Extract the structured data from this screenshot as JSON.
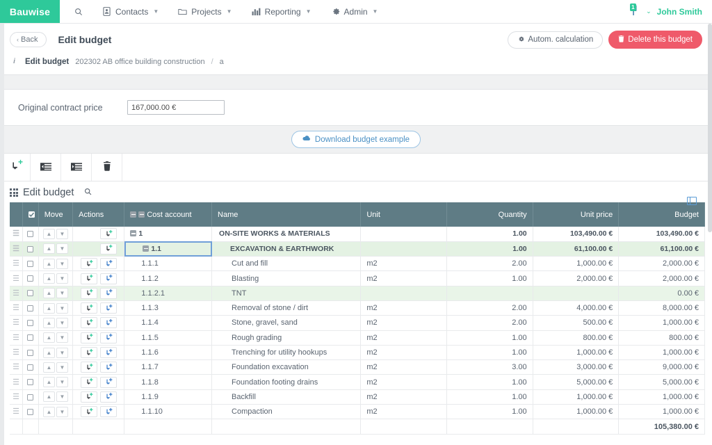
{
  "topnav": {
    "brand": "Bauwise",
    "items": [
      {
        "label": "",
        "icon": "search-icon",
        "caret": false
      },
      {
        "label": "Contacts",
        "icon": "contacts-icon",
        "caret": true
      },
      {
        "label": "Projects",
        "icon": "folder-icon",
        "caret": true
      },
      {
        "label": "Reporting",
        "icon": "chart-icon",
        "caret": true
      },
      {
        "label": "Admin",
        "icon": "gear-icon",
        "caret": true
      }
    ],
    "notification_badge": "1",
    "user_name": "John Smith"
  },
  "subheader": {
    "back_label": "Back",
    "page_title": "Edit budget",
    "autocalc_label": "Autom. calculation",
    "delete_label": "Delete this budget",
    "breadcrumb": {
      "current": "Edit budget",
      "project": "202302 AB office building construction",
      "separator": "/",
      "tail": "a"
    }
  },
  "contract": {
    "label": "Original contract price",
    "value": "167,000.00 €",
    "placeholder": ""
  },
  "download": {
    "label": "Download budget example",
    "icon": "cloud-download-icon"
  },
  "toolbar": {
    "buttons": [
      {
        "name": "add-row-button",
        "icon": "add-sub-row-icon"
      },
      {
        "name": "outdent-button",
        "icon": "outdent-icon"
      },
      {
        "name": "indent-button",
        "icon": "indent-icon"
      },
      {
        "name": "delete-row-button",
        "icon": "trash-icon"
      }
    ]
  },
  "grid": {
    "title": "Edit budget",
    "search_icon": "search-icon",
    "panel_icon": "columns-toggle-icon",
    "columns": [
      {
        "key": "handle",
        "label": ""
      },
      {
        "key": "check",
        "label": ""
      },
      {
        "key": "move",
        "label": "Move"
      },
      {
        "key": "actions",
        "label": "Actions"
      },
      {
        "key": "code",
        "label": "Cost account"
      },
      {
        "key": "name",
        "label": "Name"
      },
      {
        "key": "unit",
        "label": "Unit"
      },
      {
        "key": "qty",
        "label": "Quantity"
      },
      {
        "key": "price",
        "label": "Unit price"
      },
      {
        "key": "budget",
        "label": "Budget"
      }
    ],
    "rows": [
      {
        "code": "1",
        "name": "ON-SITE WORKS & MATERIALS",
        "unit": "",
        "qty": "1.00",
        "price": "103,490.00 €",
        "budget": "103,490.00 €",
        "level": 1,
        "collapsible": true,
        "selected": false,
        "indent": 0,
        "actions": 1
      },
      {
        "code": "1.1",
        "name": "EXCAVATION & EARTHWORK",
        "unit": "",
        "qty": "1.00",
        "price": "61,100.00 €",
        "budget": "61,100.00 €",
        "level": 2,
        "collapsible": true,
        "selected": true,
        "indent": 1,
        "actions": 1
      },
      {
        "code": "1.1.1",
        "name": "Cut and fill",
        "unit": "m2",
        "qty": "2.00",
        "price": "1,000.00 €",
        "budget": "2,000.00 €",
        "level": 3,
        "collapsible": false,
        "selected": false,
        "indent": 2,
        "actions": 2
      },
      {
        "code": "1.1.2",
        "name": "Blasting",
        "unit": "m2",
        "qty": "1.00",
        "price": "2,000.00 €",
        "budget": "2,000.00 €",
        "level": 3,
        "collapsible": false,
        "selected": false,
        "indent": 2,
        "actions": 2
      },
      {
        "code": "1.1.2.1",
        "name": "TNT",
        "unit": "",
        "qty": "",
        "price": "",
        "budget": "0.00 €",
        "level": 4,
        "collapsible": false,
        "selected": true,
        "indent": 2,
        "actions": 2
      },
      {
        "code": "1.1.3",
        "name": "Removal of stone / dirt",
        "unit": "m2",
        "qty": "2.00",
        "price": "4,000.00 €",
        "budget": "8,000.00 €",
        "level": 3,
        "collapsible": false,
        "selected": false,
        "indent": 2,
        "actions": 2
      },
      {
        "code": "1.1.4",
        "name": "Stone, gravel, sand",
        "unit": "m2",
        "qty": "2.00",
        "price": "500.00 €",
        "budget": "1,000.00 €",
        "level": 3,
        "collapsible": false,
        "selected": false,
        "indent": 2,
        "actions": 2
      },
      {
        "code": "1.1.5",
        "name": "Rough grading",
        "unit": "m2",
        "qty": "1.00",
        "price": "800.00 €",
        "budget": "800.00 €",
        "level": 3,
        "collapsible": false,
        "selected": false,
        "indent": 2,
        "actions": 2
      },
      {
        "code": "1.1.6",
        "name": "Trenching for utility hookups",
        "unit": "m2",
        "qty": "1.00",
        "price": "1,000.00 €",
        "budget": "1,000.00 €",
        "level": 3,
        "collapsible": false,
        "selected": false,
        "indent": 2,
        "actions": 2
      },
      {
        "code": "1.1.7",
        "name": "Foundation excavation",
        "unit": "m2",
        "qty": "3.00",
        "price": "3,000.00 €",
        "budget": "9,000.00 €",
        "level": 3,
        "collapsible": false,
        "selected": false,
        "indent": 2,
        "actions": 2
      },
      {
        "code": "1.1.8",
        "name": "Foundation footing drains",
        "unit": "m2",
        "qty": "1.00",
        "price": "5,000.00 €",
        "budget": "5,000.00 €",
        "level": 3,
        "collapsible": false,
        "selected": false,
        "indent": 2,
        "actions": 2
      },
      {
        "code": "1.1.9",
        "name": "Backfill",
        "unit": "m2",
        "qty": "1.00",
        "price": "1,000.00 €",
        "budget": "1,000.00 €",
        "level": 3,
        "collapsible": false,
        "selected": false,
        "indent": 2,
        "actions": 2
      },
      {
        "code": "1.1.10",
        "name": "Compaction",
        "unit": "m2",
        "qty": "1.00",
        "price": "1,000.00 €",
        "budget": "1,000.00 €",
        "level": 3,
        "collapsible": false,
        "selected": false,
        "indent": 2,
        "actions": 2
      }
    ],
    "footer": {
      "unit": "",
      "qty": "",
      "price": "",
      "budget": "105,380.00 €"
    }
  },
  "colors": {
    "brand_green": "#2ec99a",
    "table_header": "#5f7c85",
    "danger_red": "#ef5a6a",
    "link_blue": "#4a90c4",
    "group_row_green": "#e4f2e3"
  }
}
